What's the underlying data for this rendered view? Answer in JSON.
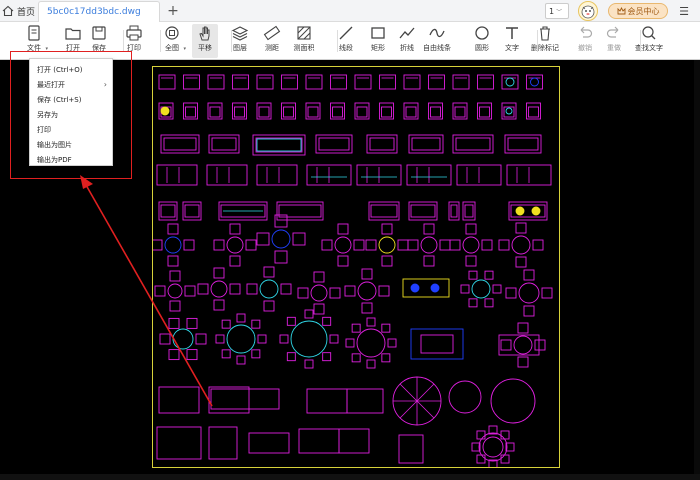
{
  "tabs": {
    "home_label": "首页",
    "file_name": "5bc0c17dd3bdc.dwg",
    "new_tab": "+"
  },
  "header": {
    "page_number": "1",
    "member_label": "会员中心",
    "menu_icon": "hamburger-icon"
  },
  "toolbar": {
    "items": [
      {
        "label": "文件",
        "icon": "file-icon",
        "has_dropdown": true
      },
      {
        "label": "打开",
        "icon": "folder-icon"
      },
      {
        "label": "保存",
        "icon": "save-icon"
      },
      {
        "label": "打印",
        "icon": "print-icon"
      },
      {
        "label": "全图",
        "icon": "fit-view-icon",
        "has_dropdown": true
      },
      {
        "label": "平移",
        "icon": "hand-icon",
        "active": true
      },
      {
        "label": "图层",
        "icon": "layers-icon"
      },
      {
        "label": "测距",
        "icon": "measure-distance-icon"
      },
      {
        "label": "测面积",
        "icon": "measure-area-icon"
      },
      {
        "label": "线段",
        "icon": "line-icon"
      },
      {
        "label": "矩形",
        "icon": "rectangle-icon"
      },
      {
        "label": "折线",
        "icon": "polyline-icon"
      },
      {
        "label": "自由线条",
        "icon": "freehand-icon"
      },
      {
        "label": "圆形",
        "icon": "circle-icon"
      },
      {
        "label": "文字",
        "icon": "text-icon"
      },
      {
        "label": "删除标记",
        "icon": "trash-icon"
      },
      {
        "label": "撤销",
        "icon": "undo-icon",
        "disabled": true
      },
      {
        "label": "重做",
        "icon": "redo-icon",
        "disabled": true
      },
      {
        "label": "查找文字",
        "icon": "find-text-icon"
      }
    ]
  },
  "file_menu": {
    "items": [
      {
        "label": "打开 (Ctrl+O)"
      },
      {
        "label": "最近打开",
        "has_submenu": true
      },
      {
        "label": "保存 (Ctrl+S)"
      },
      {
        "label": "另存为"
      },
      {
        "label": "打印"
      },
      {
        "label": "输出为图片"
      },
      {
        "label": "输出为PDF"
      }
    ]
  },
  "colors": {
    "canvas": "#000000",
    "frame": "#d7d23a",
    "stroke_magenta": "#e020e0",
    "stroke_cyan": "#30d8e8",
    "stroke_yellow": "#f0e020",
    "stroke_blue": "#2040ff",
    "annotation_red": "#e02020"
  }
}
